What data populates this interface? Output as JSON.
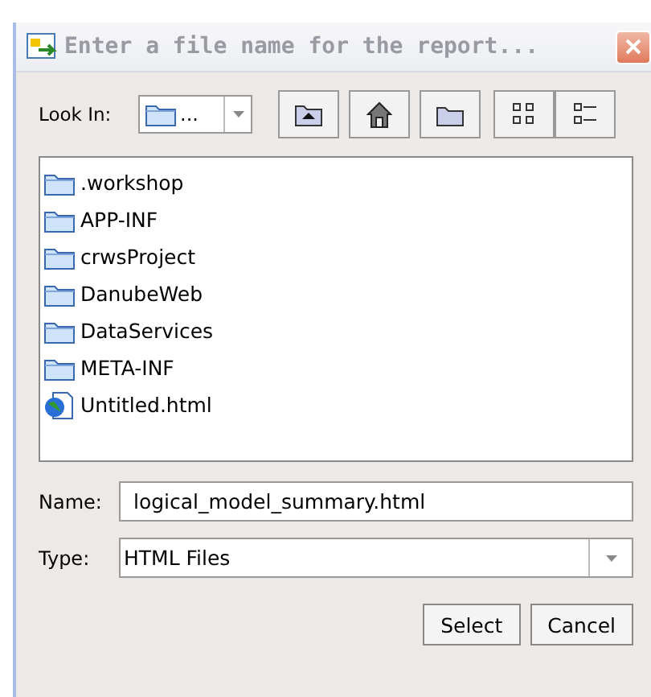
{
  "window": {
    "title": "Enter a file name for the report...",
    "active": false
  },
  "look_in": {
    "label": "Look In:",
    "value": "..."
  },
  "toolbar": [
    {
      "kind": "up"
    },
    {
      "kind": "home"
    },
    {
      "kind": "new-folder"
    },
    {
      "kind": "icons-view"
    },
    {
      "kind": "list-view"
    }
  ],
  "files": [
    {
      "name": ".workshop",
      "kind": "folder"
    },
    {
      "name": "APP-INF",
      "kind": "folder"
    },
    {
      "name": "crwsProject",
      "kind": "folder"
    },
    {
      "name": "DanubeWeb",
      "kind": "folder"
    },
    {
      "name": "DataServices",
      "kind": "folder"
    },
    {
      "name": "META-INF",
      "kind": "folder"
    },
    {
      "name": "Untitled.html",
      "kind": "html"
    }
  ],
  "name_field": {
    "label": "Name:",
    "value": "logical_model_summary.html"
  },
  "type_field": {
    "label": "Type:",
    "value": "HTML Files"
  },
  "buttons": [
    "Select",
    "Cancel"
  ]
}
